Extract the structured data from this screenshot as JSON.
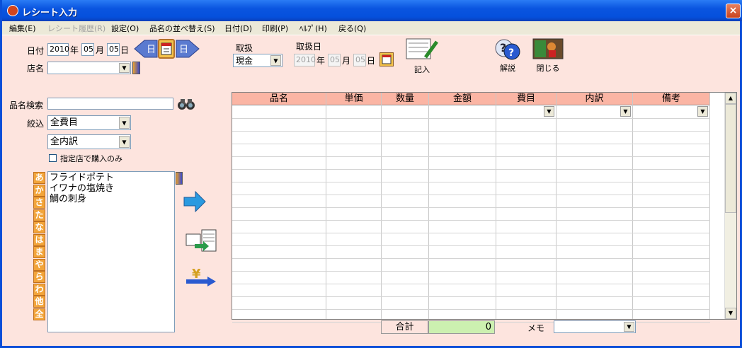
{
  "window": {
    "title": "レシート入力",
    "close_label": "×"
  },
  "menu": [
    "編集(E)",
    "レシート履歴(R)",
    "設定(O)",
    "品名の並べ替え(S)",
    "日付(D)",
    "印刷(P)",
    "ﾍﾙﾌﾟ(H)",
    "戻る(Q)"
  ],
  "date": {
    "label": "日付",
    "year": "2010",
    "year_unit": "年",
    "month": "05",
    "month_unit": "月",
    "day": "05",
    "day_unit": "日",
    "prev": "日",
    "next": "日"
  },
  "store": {
    "label": "店名",
    "value": ""
  },
  "handling": {
    "label": "取扱",
    "value": "現金"
  },
  "handling_date": {
    "label": "取扱日",
    "year": "2010",
    "year_unit": "年",
    "month": "05",
    "month_unit": "月",
    "day": "05",
    "day_unit": "日"
  },
  "buttons": {
    "record": "記入",
    "help": "解説",
    "close": "閉じる"
  },
  "search": {
    "label": "品名検索",
    "value": ""
  },
  "filter": {
    "label": "絞込",
    "category": "全費目",
    "detail": "全内訳",
    "store_only": "指定店で購入のみ"
  },
  "kana_tabs": [
    "あ",
    "か",
    "さ",
    "た",
    "な",
    "は",
    "ま",
    "や",
    "ら",
    "わ",
    "他",
    "全"
  ],
  "item_list": [
    "フライドポテト",
    "イワナの塩焼き",
    "鯛の刺身"
  ],
  "grid": {
    "headers": [
      "品名",
      "単価",
      "数量",
      "金額",
      "費目",
      "内訳",
      "備考"
    ]
  },
  "footer": {
    "total_label": "合計",
    "total_value": "0",
    "memo_label": "メモ",
    "memo_value": ""
  },
  "colors": {
    "background": "#fde4de",
    "header": "#fbb5a4",
    "total": "#ccf0b0",
    "kana": "#f2a43a"
  }
}
